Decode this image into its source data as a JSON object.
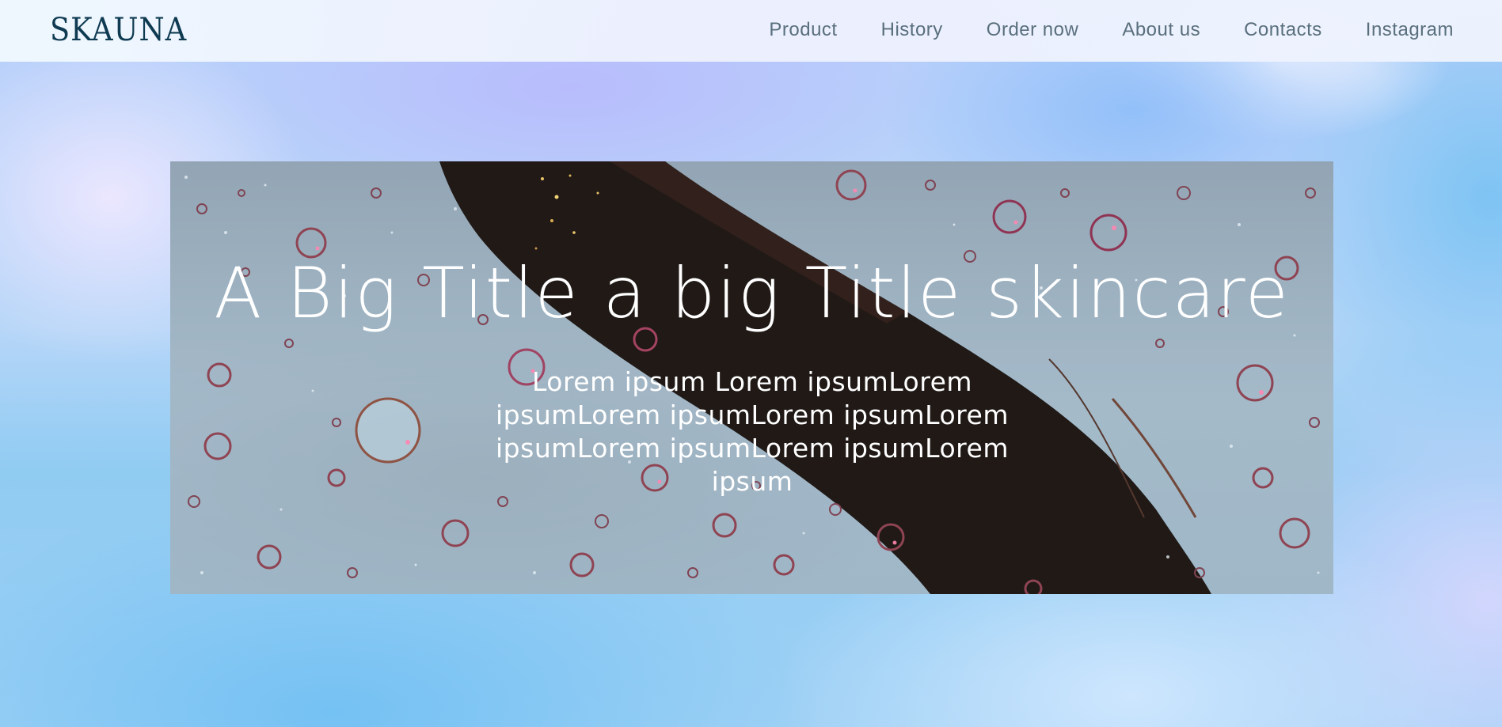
{
  "header": {
    "logo_text": "SKAUNA",
    "nav": [
      {
        "label": "Product"
      },
      {
        "label": "History"
      },
      {
        "label": "Order now"
      },
      {
        "label": "About us"
      },
      {
        "label": "Contacts"
      },
      {
        "label": "Instagram"
      }
    ]
  },
  "hero": {
    "title": "A Big Title a big Title skincare",
    "subtitle": "Lorem ipsum Lorem ipsumLorem ipsumLorem ipsumLorem ipsumLorem ipsumLorem ipsumLorem ipsumLorem ipsum"
  },
  "colors": {
    "logo": "#0f3b52",
    "nav_text": "#5a6f7d",
    "hero_text": "#ffffff"
  }
}
